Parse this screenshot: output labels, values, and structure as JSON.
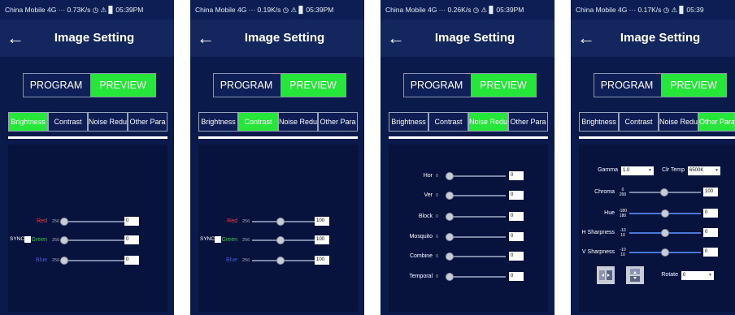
{
  "screens": [
    {
      "status": "China Mobile 4G ···  0.73K/s ◷ ⚠ ▊ 05:39PM",
      "title": "Image Setting",
      "mode": {
        "program": "PROGRAM",
        "preview": "PREVIEW"
      },
      "tabs": [
        "Brightness",
        "Contrast",
        "Noise Reduc",
        "Other Para"
      ],
      "active_tab": 0,
      "sync_label": "SYNC",
      "rows": [
        {
          "label": "Red",
          "color": "#ff3b3b",
          "min": "256",
          "value": "0",
          "level": 0.0
        },
        {
          "label": "Green",
          "color": "#31d13e",
          "min": "256",
          "value": "0",
          "level": 0.0
        },
        {
          "label": "Blue",
          "color": "#3b5bff",
          "min": "256",
          "value": "0",
          "level": 0.0
        }
      ]
    },
    {
      "status": "China Mobile 4G ···  0.19K/s ◷ ⚠ ▊ 05:39PM",
      "title": "Image Setting",
      "mode": {
        "program": "PROGRAM",
        "preview": "PREVIEW"
      },
      "tabs": [
        "Brightness",
        "Contrast",
        "Noise Reduc",
        "Other Para"
      ],
      "active_tab": 1,
      "sync_label": "SYNC",
      "rows": [
        {
          "label": "Red",
          "color": "#ff3b3b",
          "min": "256",
          "value": "100",
          "level": 0.4
        },
        {
          "label": "Green",
          "color": "#31d13e",
          "min": "256",
          "value": "100",
          "level": 0.4
        },
        {
          "label": "Blue",
          "color": "#3b5bff",
          "min": "256",
          "value": "100",
          "level": 0.4
        }
      ]
    },
    {
      "status": "China Mobile 4G ···  0.26K/s ◷ ⚠ ▊ 05:39PM",
      "title": "Image Setting",
      "mode": {
        "program": "PROGRAM",
        "preview": "PREVIEW"
      },
      "tabs": [
        "Brightness",
        "Contrast",
        "Noise Reduc",
        "Other Para"
      ],
      "active_tab": 2,
      "rows": [
        {
          "label": "Hor",
          "min": "0",
          "value": "0",
          "level": 0.0
        },
        {
          "label": "Ver",
          "min": "0",
          "value": "0",
          "level": 0.0
        },
        {
          "label": "Block",
          "min": "0",
          "value": "0",
          "level": 0.0
        },
        {
          "label": "Mosquito",
          "min": "0",
          "value": "0",
          "level": 0.0
        },
        {
          "label": "Combine",
          "min": "0",
          "value": "0",
          "level": 0.0
        },
        {
          "label": "Temporal",
          "min": "0",
          "value": "0",
          "level": 0.0
        }
      ]
    },
    {
      "status": "China Mobile 4G ···  0.17K/s ◷ ⚠ ▊ 05:39",
      "title": "Image Setting",
      "mode": {
        "program": "PROGRAM",
        "preview": "PREVIEW"
      },
      "tabs": [
        "Brightness",
        "Contrast",
        "Noise Reduc",
        "Other Para"
      ],
      "active_tab": 3,
      "gamma_label": "Gamma",
      "gamma_value": "1.0",
      "clr_temp_label": "Clr Temp",
      "clr_temp_value": "6500K",
      "rows": [
        {
          "label": "Chroma",
          "num": "0",
          "den": "200",
          "value": "100",
          "level": 0.5
        },
        {
          "label": "Hue",
          "num": "-180",
          "den": "180",
          "value": "0",
          "level": 0.5
        },
        {
          "label": "H Sharpness",
          "num": "-10",
          "den": "10",
          "value": "0",
          "level": 0.5
        },
        {
          "label": "V Sharpness",
          "num": "-10",
          "den": "10",
          "value": "0",
          "level": 0.5
        }
      ],
      "rotate_label": "Rotate",
      "rotate_value": "0"
    }
  ]
}
